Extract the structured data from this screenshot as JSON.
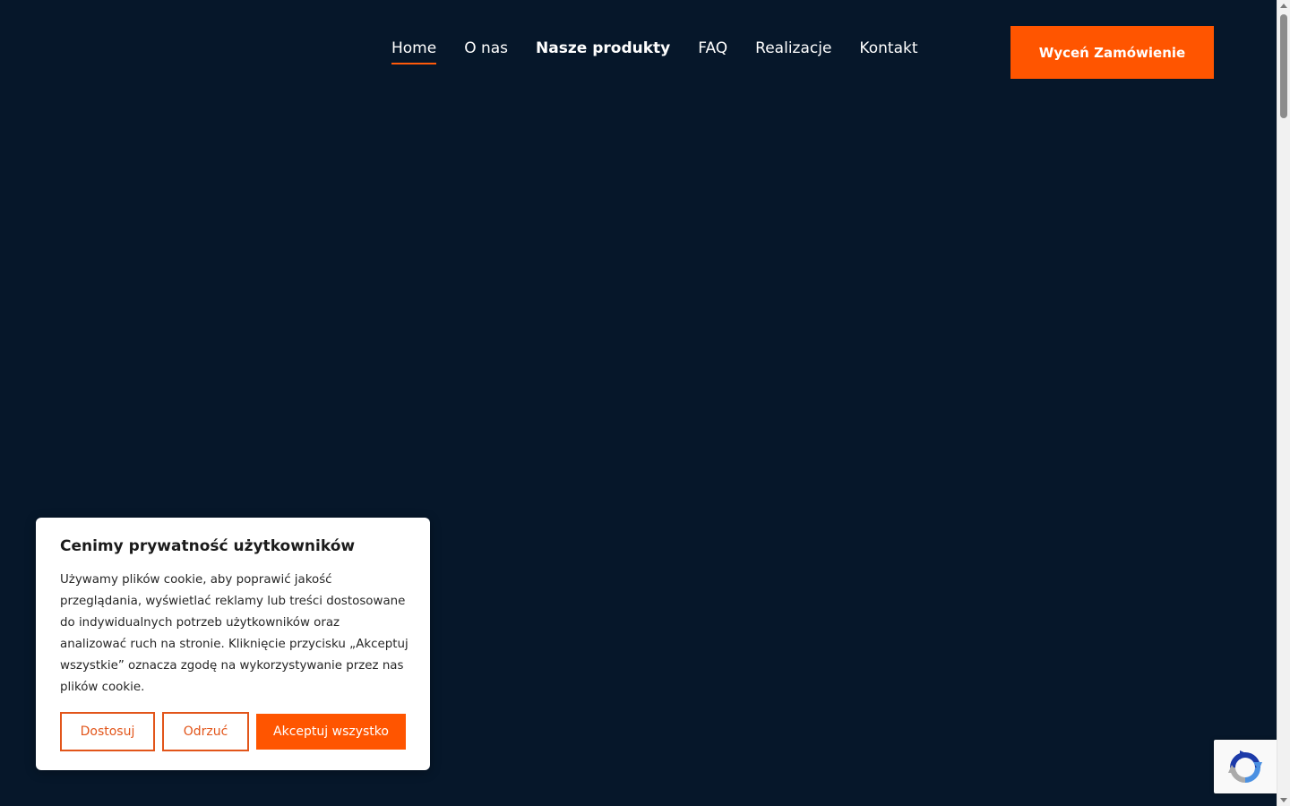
{
  "nav": {
    "items": [
      {
        "label": "Home",
        "active": true,
        "bold": false
      },
      {
        "label": "O nas",
        "active": false,
        "bold": false
      },
      {
        "label": "Nasze produkty",
        "active": false,
        "bold": true
      },
      {
        "label": "FAQ",
        "active": false,
        "bold": false
      },
      {
        "label": "Realizacje",
        "active": false,
        "bold": false
      },
      {
        "label": "Kontakt",
        "active": false,
        "bold": false
      }
    ],
    "cta_label": "Wyceń Zamówienie"
  },
  "cookie": {
    "title": "Cenimy prywatność użytkowników",
    "text": "Używamy plików cookie, aby poprawić jakość przeglądania, wyświetlać reklamy lub treści dostosowane do indywidualnych potrzeb użytkowników oraz analizować ruch na stronie. Kliknięcie przycisku „Akceptuj wszystkie” oznacza zgodę na wykorzystywanie przez nas plików cookie.",
    "customize_label": "Dostosuj",
    "reject_label": "Odrzuć",
    "accept_label": "Akceptuj wszystko"
  },
  "icons": {
    "recaptcha": "recaptcha-icon"
  },
  "colors": {
    "background": "#06172a",
    "accent": "#ff5500"
  }
}
